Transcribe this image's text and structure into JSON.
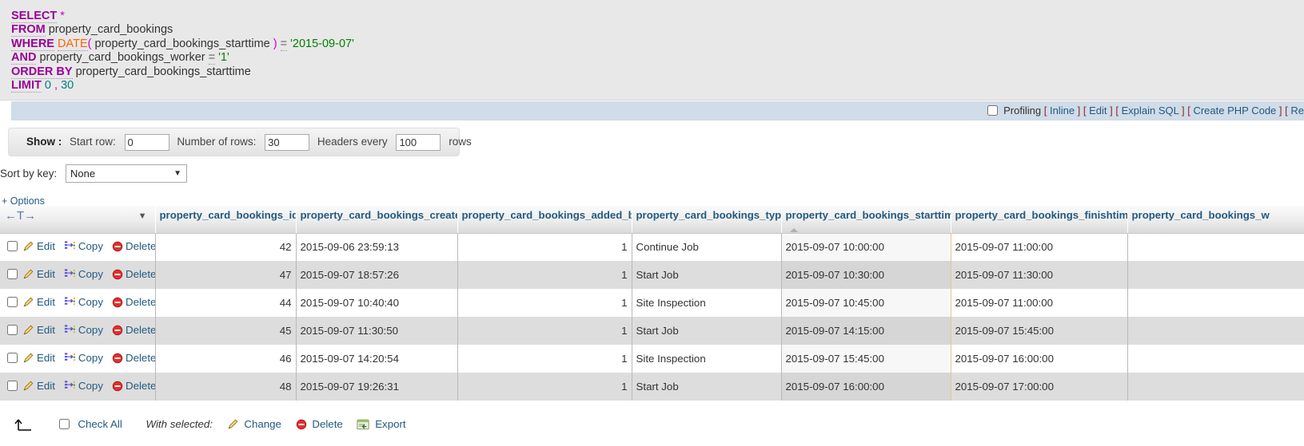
{
  "sql": {
    "lines": [
      [
        {
          "t": "SELECT",
          "c": "kw"
        },
        {
          "t": " ",
          "c": "idn"
        },
        {
          "t": "*",
          "c": "star"
        }
      ],
      [
        {
          "t": "FROM",
          "c": "kw"
        },
        {
          "t": " property_card_bookings",
          "c": "idn"
        }
      ],
      [
        {
          "t": "WHERE",
          "c": "kw"
        },
        {
          "t": " ",
          "c": "idn"
        },
        {
          "t": "DATE",
          "c": "fn"
        },
        {
          "t": "(",
          "c": "pun"
        },
        {
          "t": " property_card_bookings_starttime ",
          "c": "idn"
        },
        {
          "t": ")",
          "c": "pun"
        },
        {
          "t": " ",
          "c": "idn"
        },
        {
          "t": "=",
          "c": "eq"
        },
        {
          "t": " ",
          "c": "idn"
        },
        {
          "t": "'2015-09-07'",
          "c": "str"
        }
      ],
      [
        {
          "t": "AND",
          "c": "kw"
        },
        {
          "t": " property_card_bookings_worker ",
          "c": "idn"
        },
        {
          "t": "=",
          "c": "eq"
        },
        {
          "t": " ",
          "c": "idn"
        },
        {
          "t": "'1'",
          "c": "str"
        }
      ],
      [
        {
          "t": "ORDER BY",
          "c": "kw"
        },
        {
          "t": " property_card_bookings_starttime",
          "c": "idn"
        }
      ],
      [
        {
          "t": "LIMIT",
          "c": "kw"
        },
        {
          "t": " ",
          "c": "idn"
        },
        {
          "t": "0",
          "c": "num"
        },
        {
          "t": " , ",
          "c": "pun"
        },
        {
          "t": "30",
          "c": "num"
        }
      ]
    ],
    "plain": "SELECT *\nFROM property_card_bookings\nWHERE DATE( property_card_bookings_starttime ) = '2015-09-07'\nAND property_card_bookings_worker = '1'\nORDER BY property_card_bookings_starttime\nLIMIT 0 , 30"
  },
  "profiling": {
    "label": "Profiling",
    "checked": false,
    "links": [
      "Inline",
      "Edit",
      "Explain SQL",
      "Create PHP Code",
      "Re"
    ]
  },
  "show_panel": {
    "title": "Show :",
    "start_row_label": "Start row:",
    "start_row_value": "0",
    "number_of_rows_label": "Number of rows:",
    "number_of_rows_value": "30",
    "headers_every_label": "Headers every",
    "headers_every_value": "100",
    "rows_suffix": "rows"
  },
  "sort_by_key": {
    "label": "Sort by key:",
    "selected": "None",
    "options": [
      "None"
    ]
  },
  "options_link": "+ Options",
  "table": {
    "nav_col_label": "←T→",
    "columns": [
      "property_card_bookings_id",
      "property_card_bookings_created",
      "property_card_bookings_added_by",
      "property_card_bookings_type",
      "property_card_bookings_starttime",
      "property_card_bookings_finishtime",
      "property_card_bookings_w"
    ],
    "sorted_column": "property_card_bookings_starttime",
    "sort_direction": "asc",
    "actions": {
      "edit": "Edit",
      "copy": "Copy",
      "delete": "Delete"
    },
    "rows": [
      {
        "id": "42",
        "created": "2015-09-06 23:59:13",
        "added_by": "",
        "type_num": "1",
        "type": "Continue Job",
        "starttime": "2015-09-07 10:00:00",
        "finishtime": "2015-09-07 11:00:00",
        "worker": ""
      },
      {
        "id": "47",
        "created": "2015-09-07 18:57:26",
        "added_by": "",
        "type_num": "1",
        "type": "Start Job",
        "starttime": "2015-09-07 10:30:00",
        "finishtime": "2015-09-07 11:30:00",
        "worker": ""
      },
      {
        "id": "44",
        "created": "2015-09-07 10:40:40",
        "added_by": "",
        "type_num": "1",
        "type": "Site Inspection",
        "starttime": "2015-09-07 10:45:00",
        "finishtime": "2015-09-07 11:00:00",
        "worker": ""
      },
      {
        "id": "45",
        "created": "2015-09-07 11:30:50",
        "added_by": "",
        "type_num": "1",
        "type": "Start Job",
        "starttime": "2015-09-07 14:15:00",
        "finishtime": "2015-09-07 15:45:00",
        "worker": ""
      },
      {
        "id": "46",
        "created": "2015-09-07 14:20:54",
        "added_by": "",
        "type_num": "1",
        "type": "Site Inspection",
        "starttime": "2015-09-07 15:45:00",
        "finishtime": "2015-09-07 16:00:00",
        "worker": ""
      },
      {
        "id": "48",
        "created": "2015-09-07 19:26:31",
        "added_by": "",
        "type_num": "1",
        "type": "Start Job",
        "starttime": "2015-09-07 16:00:00",
        "finishtime": "2015-09-07 17:00:00",
        "worker": ""
      }
    ]
  },
  "bottom_bar": {
    "check_all": "Check All",
    "with_selected": "With selected:",
    "change": "Change",
    "delete": "Delete",
    "export": "Export"
  },
  "colors": {
    "link": "#235a81",
    "keyword": "#990099",
    "function": "#ff6600",
    "string": "#008000",
    "number": "#008080",
    "header_text": "#235a81",
    "profiling_bg": "#d0dce8",
    "sql_bg": "#e8e8e8",
    "row_even": "#dddddd",
    "row_odd": "#ffffff",
    "sorted_border": "#e8c39a"
  }
}
